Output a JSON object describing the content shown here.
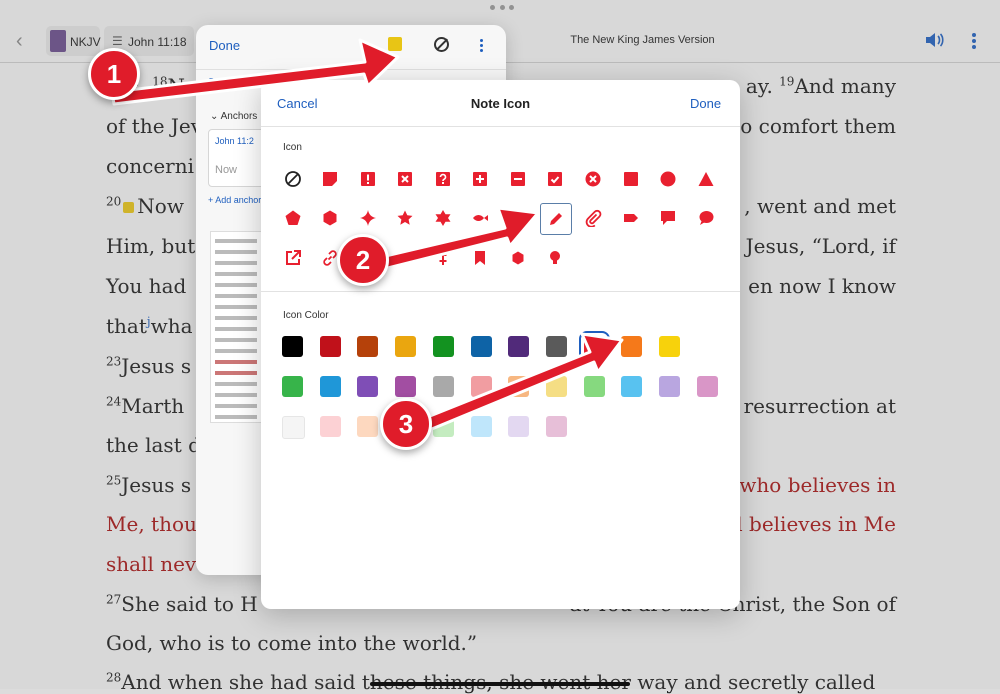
{
  "toolbar": {
    "version_label": "NKJV",
    "reference": "John 11:18",
    "title": "The New King James Version"
  },
  "scripture": {
    "lines": [
      {
        "sup": "",
        "text": "ays. ",
        "sup2": "18",
        "text2": "N"
      },
      {
        "text": "of the Jev"
      },
      {
        "text": "concerni"
      },
      {
        "sup": "20",
        "text": "Now"
      },
      {
        "text": "Him, but"
      },
      {
        "text": "You had"
      },
      {
        "text": "that",
        "sup": "j",
        "text2": "wha"
      },
      {
        "sup": "23",
        "text": "Jesus s"
      },
      {
        "sup": "24",
        "text": "Marth"
      },
      {
        "text": "the last d"
      },
      {
        "sup": "25",
        "text": "Jesus s"
      },
      {
        "text": "Me, thou"
      },
      {
        "text": "shall nev"
      },
      {
        "sup": "27",
        "text": "She said to H"
      },
      {
        "text": "God, who is to come into the world.”"
      },
      {
        "sup": "28",
        "text": "And when she had said these things, she went her way and secretly called"
      }
    ],
    "right_lines": [
      {
        "text": "ay. ",
        "sup": "19",
        "text2": "And many"
      },
      {
        "text": "o comfort them"
      },
      {
        "text": ", went and met"
      },
      {
        "text": "Jesus, “Lord, if"
      },
      {
        "text": "en now I know"
      },
      {
        "text": "resurrection at"
      },
      {
        "text": "who believes in"
      },
      {
        "text": "d believes in Me"
      },
      {
        "text": "at You are the Christ, the Son of"
      }
    ]
  },
  "note_panel": {
    "done": "Done",
    "set_note": "Set Note",
    "anchors": "Anchors",
    "anchor_ref": "John 11:2",
    "anchor_time": "Now",
    "add_anchor": "+ Add anchor"
  },
  "dialog": {
    "cancel": "Cancel",
    "title": "Note Icon",
    "done": "Done",
    "icon_section": "Icon",
    "color_section": "Icon Color",
    "icons": [
      "no-symbol-icon",
      "sticky-note-icon",
      "exclamation-square-icon",
      "x-square-icon",
      "question-square-icon",
      "plus-square-icon",
      "minus-square-icon",
      "checkmark-square-icon",
      "x-circle-icon",
      "square-icon",
      "circle-icon",
      "triangle-icon",
      "pentagon-icon",
      "hexagon-icon",
      "sparkle-star-icon",
      "star-icon",
      "six-point-star-icon",
      "fish-icon",
      "broken-heart-icon",
      "pencil-icon",
      "paperclip-icon",
      "tag-icon",
      "square-speech-bubble-icon",
      "round-speech-bubble-icon",
      "external-link-icon",
      "link-icon",
      "",
      "",
      "dagger-icon",
      "double-dagger-icon",
      "bookmark-icon",
      "hexagon-small-icon",
      "lightbulb-icon"
    ],
    "selected_icon": "pencil-icon",
    "icon_color": "#e8202f",
    "colors_row1": [
      "#000000",
      "#c0111a",
      "#b5410a",
      "#eaa60f",
      "#139220",
      "#0e63a6",
      "#512a7a",
      "#5a5a5a",
      "#e8202f",
      "#f5791a",
      "#f7d20c"
    ],
    "colors_row2": [
      "#37b44a",
      "#1f97d8",
      "#7f4eb6",
      "#a24ea2",
      "#a9a9a9",
      "#f19da1",
      "#f7b781",
      "#f5de84",
      "#86d97f",
      "#58c2f0",
      "#b9a6e0",
      "#d996c7"
    ],
    "colors_row3": [
      "#f5f5f5",
      "#fcd1d4",
      "#fdd8bf",
      "#dedede",
      "#c4ecc0",
      "#bfe6fb",
      "#e3d8f1",
      "#e7bfd8"
    ],
    "selected_color": "#e8202f"
  },
  "callouts": [
    "1",
    "2",
    "3"
  ],
  "colors": {
    "accent": "#1f5fbf",
    "annotation_red": "#e01c2a",
    "red_letter": "#a81414"
  }
}
